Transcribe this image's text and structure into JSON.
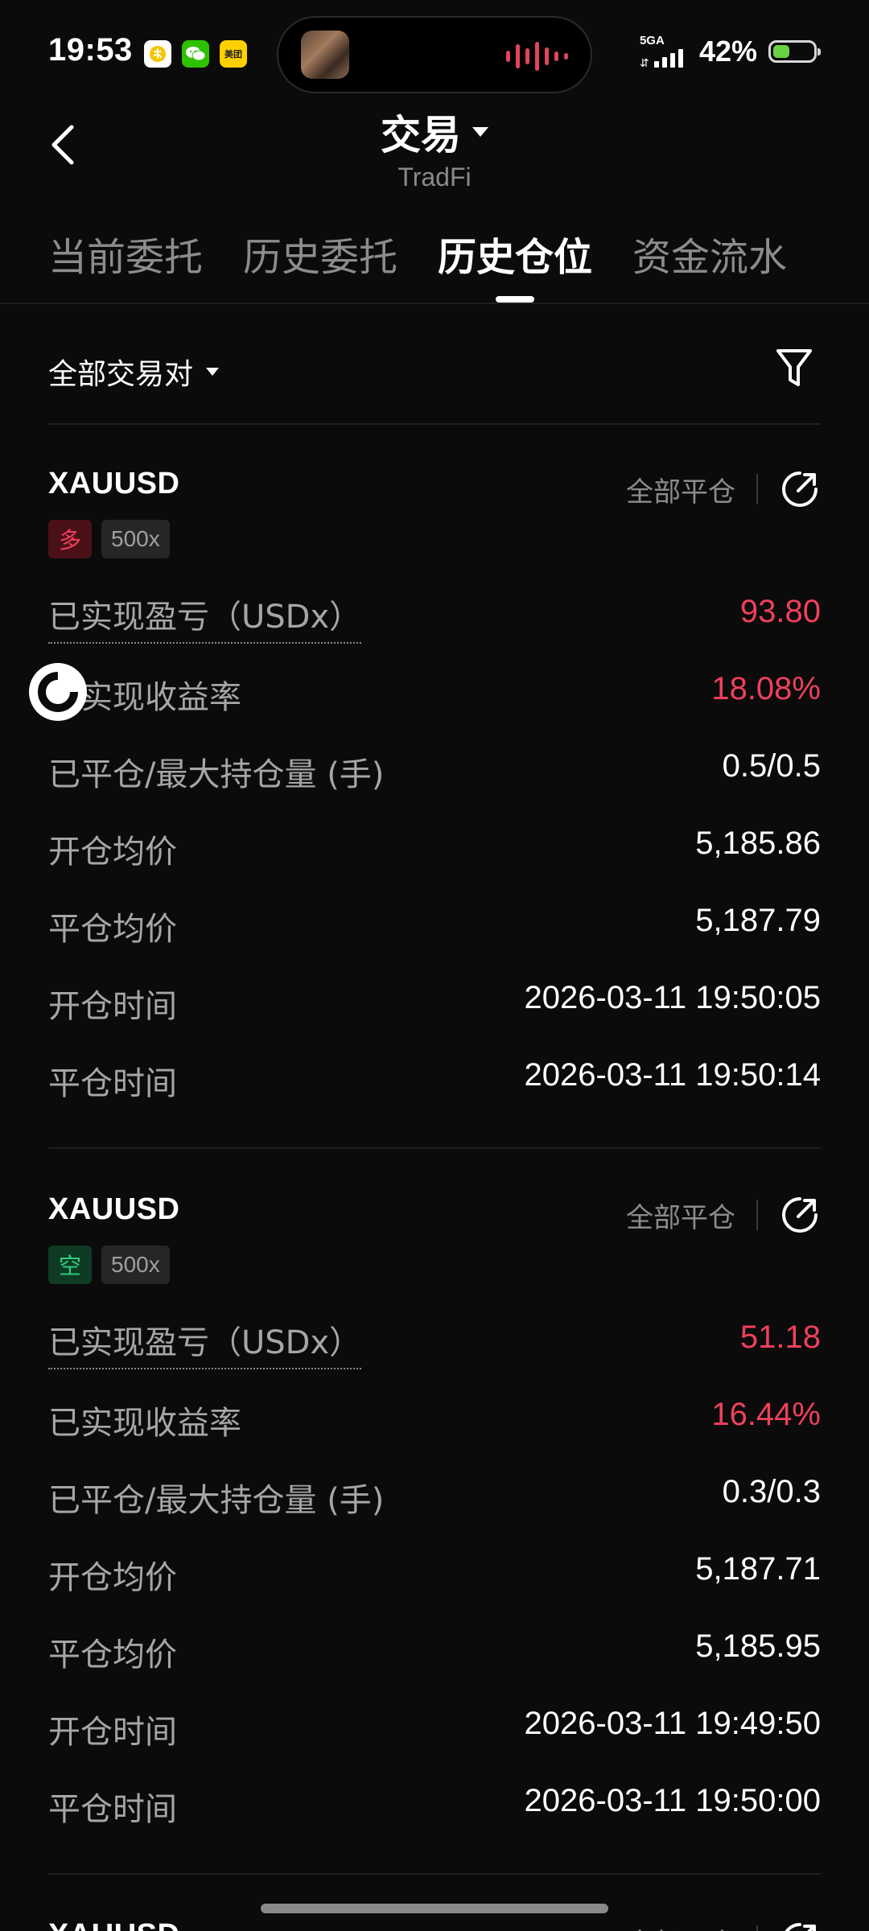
{
  "status_bar": {
    "time": "19:53",
    "app_icons": [
      "alipay-icon",
      "wechat-icon",
      "meituan-icon"
    ],
    "meituan_label": "美团",
    "network_label": "5GA",
    "battery_percent_text": "42%",
    "battery_level": 0.42
  },
  "header": {
    "title": "交易",
    "subtitle": "TradFi"
  },
  "tabs": [
    {
      "label": "当前委托",
      "active": false
    },
    {
      "label": "历史委托",
      "active": false
    },
    {
      "label": "历史仓位",
      "active": true
    },
    {
      "label": "资金流水",
      "active": false
    }
  ],
  "filter": {
    "pair_selector_label": "全部交易对"
  },
  "colors": {
    "background": "#0b0b0b",
    "profit_red": "#f0405c",
    "long_tag_bg": "#4a1018",
    "short_tag_text": "#2ecf7a",
    "muted_text": "#a6a6a6"
  },
  "positions": [
    {
      "symbol": "XAUUSD",
      "close_all_label": "全部平仓",
      "direction": "多",
      "leverage": "500x",
      "rows": [
        {
          "label": "已实现盈亏（USDx）",
          "value": "93.80"
        },
        {
          "label": "已实现收益率",
          "value": "18.08%"
        },
        {
          "label": "已平仓/最大持仓量 (手)",
          "value": "0.5/0.5"
        },
        {
          "label": "开仓均价",
          "value": "5,185.86"
        },
        {
          "label": "平仓均价",
          "value": "5,187.79"
        },
        {
          "label": "开仓时间",
          "value": "2026-03-11 19:50:05"
        },
        {
          "label": "平仓时间",
          "value": "2026-03-11 19:50:14"
        }
      ]
    },
    {
      "symbol": "XAUUSD",
      "close_all_label": "全部平仓",
      "direction": "空",
      "leverage": "500x",
      "rows": [
        {
          "label": "已实现盈亏（USDx）",
          "value": "51.18"
        },
        {
          "label": "已实现收益率",
          "value": "16.44%"
        },
        {
          "label": "已平仓/最大持仓量 (手)",
          "value": "0.3/0.3"
        },
        {
          "label": "开仓均价",
          "value": "5,187.71"
        },
        {
          "label": "平仓均价",
          "value": "5,185.95"
        },
        {
          "label": "开仓时间",
          "value": "2026-03-11 19:49:50"
        },
        {
          "label": "平仓时间",
          "value": "2026-03-11 19:50:00"
        }
      ]
    },
    {
      "symbol": "XAUUSD",
      "close_all_label": "全部平仓"
    }
  ]
}
